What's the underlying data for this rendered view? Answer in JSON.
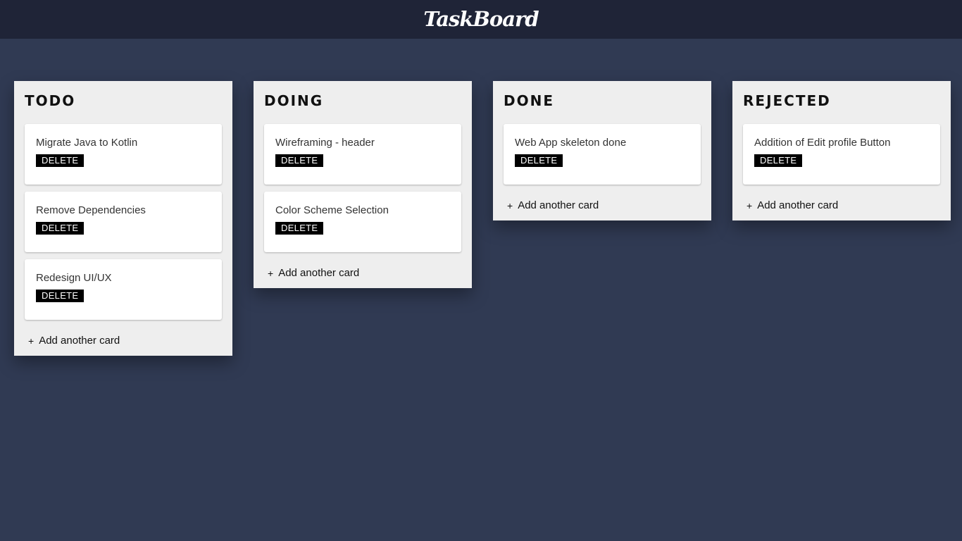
{
  "header": {
    "title": "TaskBoard"
  },
  "lists": [
    {
      "title": "TODO",
      "cards": [
        {
          "title": "Migrate Java to Kotlin",
          "delete_label": "DELETE"
        },
        {
          "title": "Remove Dependencies",
          "delete_label": "DELETE"
        },
        {
          "title": "Redesign UI/UX",
          "delete_label": "DELETE"
        }
      ],
      "add_label": "Add another card"
    },
    {
      "title": "DOING",
      "cards": [
        {
          "title": "Wireframing - header",
          "delete_label": "DELETE"
        },
        {
          "title": "Color Scheme Selection",
          "delete_label": "DELETE"
        }
      ],
      "add_label": "Add another card"
    },
    {
      "title": "DONE",
      "cards": [
        {
          "title": "Web App skeleton done",
          "delete_label": "DELETE"
        }
      ],
      "add_label": "Add another card"
    },
    {
      "title": "REJECTED",
      "cards": [
        {
          "title": "Addition of Edit profile Button",
          "delete_label": "DELETE"
        }
      ],
      "add_label": "Add another card"
    }
  ],
  "icons": {
    "add": "plus-icon",
    "add_glyph": "+"
  },
  "colors": {
    "background": "#303a53",
    "header": "#1f2437",
    "list": "#eeeeee",
    "card": "#ffffff",
    "button": "#000000"
  }
}
